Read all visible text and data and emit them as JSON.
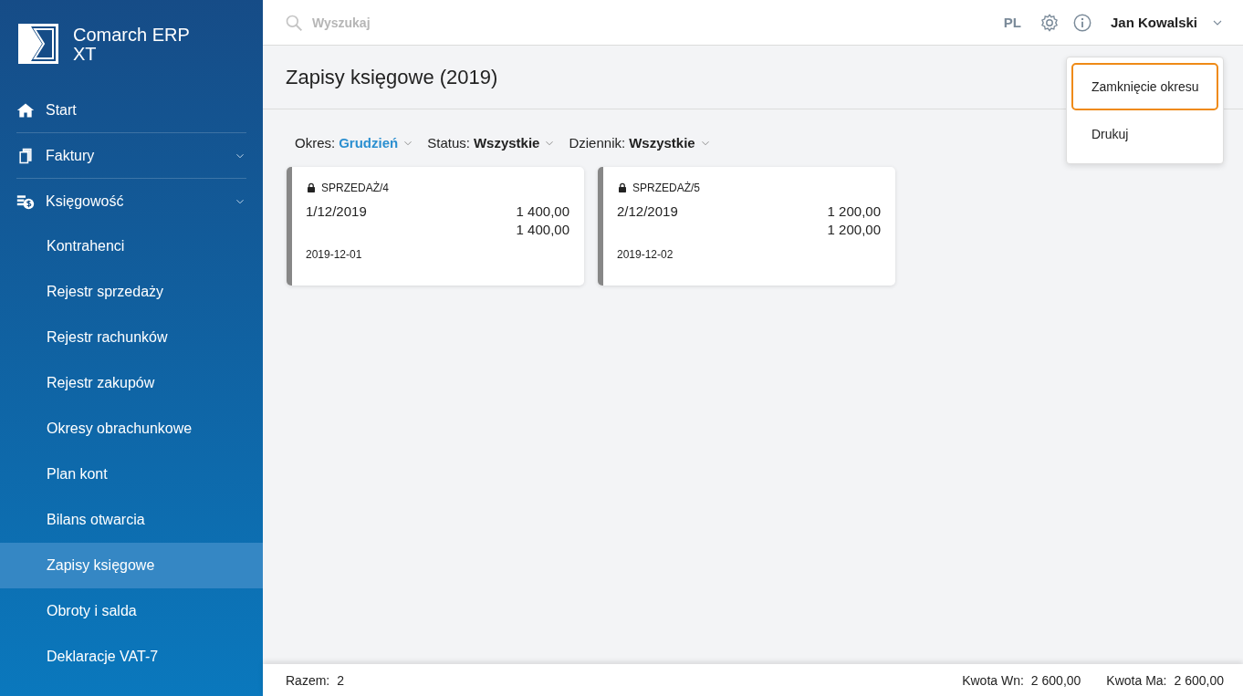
{
  "app": {
    "name_line1": "Comarch ERP",
    "name_line2": "XT"
  },
  "sidebar": {
    "items": [
      {
        "label": "Start",
        "kind": "home",
        "expandable": false
      },
      {
        "label": "Faktury",
        "kind": "documents",
        "expandable": true
      },
      {
        "label": "Księgowość",
        "kind": "coins",
        "expandable": true,
        "children": [
          {
            "label": "Kontrahenci",
            "selected": false
          },
          {
            "label": "Rejestr sprzedaży",
            "selected": false
          },
          {
            "label": "Rejestr rachunków",
            "selected": false
          },
          {
            "label": "Rejestr zakupów",
            "selected": false
          },
          {
            "label": "Okresy obrachunkowe",
            "selected": false
          },
          {
            "label": "Plan kont",
            "selected": false
          },
          {
            "label": "Bilans otwarcia",
            "selected": false
          },
          {
            "label": "Zapisy księgowe",
            "selected": true
          },
          {
            "label": "Obroty i salda",
            "selected": false
          },
          {
            "label": "Deklaracje VAT-7",
            "selected": false
          }
        ]
      }
    ]
  },
  "topbar": {
    "search": {
      "placeholder": "Wyszukaj"
    },
    "language": "PL",
    "user": "Jan Kowalski"
  },
  "page": {
    "title": "Zapisy księgowe (2019)"
  },
  "filters": [
    {
      "label": "Okres:",
      "value": "Grudzień",
      "accent": true
    },
    {
      "label": "Status:",
      "value": "Wszystkie",
      "accent": false
    },
    {
      "label": "Dziennik:",
      "value": "Wszystkie",
      "accent": false
    }
  ],
  "cards": [
    {
      "journal": "SPRZEDAŻ/4",
      "number": "1/12/2019",
      "debit": "1 400,00",
      "credit": "1 400,00",
      "date": "2019-12-01",
      "locked": true
    },
    {
      "journal": "SPRZEDAŻ/5",
      "number": "2/12/2019",
      "debit": "1 200,00",
      "credit": "1 200,00",
      "date": "2019-12-02",
      "locked": true
    }
  ],
  "menu": [
    {
      "label": "Zamknięcie okresu",
      "selected": true
    },
    {
      "label": "Drukuj",
      "selected": false
    }
  ],
  "footer": {
    "count_label": "Razem:",
    "count": "2",
    "debit_label": "Kwota Wn:",
    "debit": "2 600,00",
    "credit_label": "Kwota Ma:",
    "credit": "2 600,00"
  }
}
